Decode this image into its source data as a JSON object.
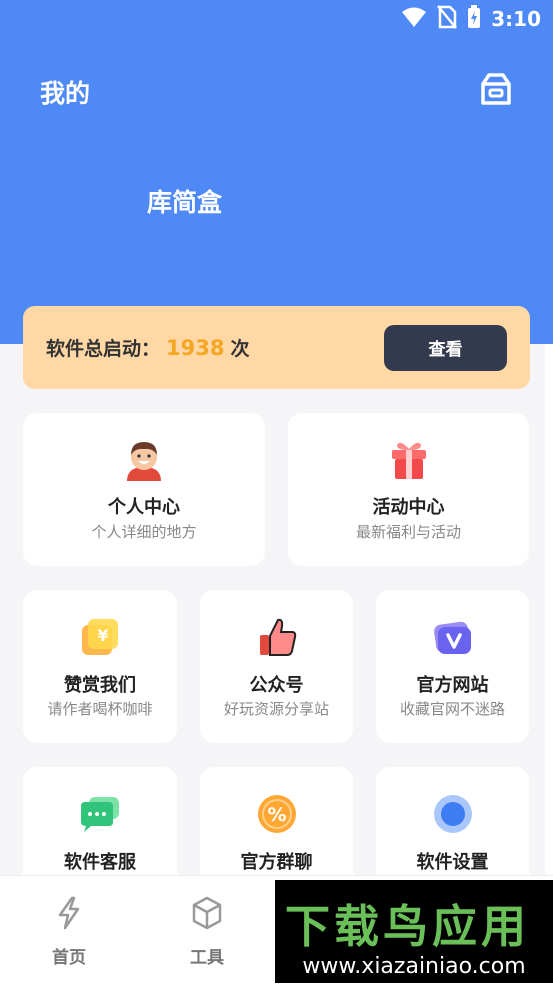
{
  "status_bar": {
    "time": "3:10"
  },
  "header": {
    "title": "我的",
    "app_name": "库简盒"
  },
  "launch": {
    "prefix": "软件总启动：",
    "count": "1938",
    "suffix": "次",
    "button": "查看"
  },
  "features_top": [
    {
      "label": "个人中心",
      "sub": "个人详细的地方",
      "icon": "avatar-icon"
    },
    {
      "label": "活动中心",
      "sub": "最新福利与活动",
      "icon": "gift-icon"
    }
  ],
  "features_row2": [
    {
      "label": "赞赏我们",
      "sub": "请作者喝杯咖啡",
      "icon": "yen-icon"
    },
    {
      "label": "公众号",
      "sub": "好玩资源分享站",
      "icon": "thumbs-up-icon"
    },
    {
      "label": "官方网站",
      "sub": "收藏官网不迷路",
      "icon": "website-icon"
    }
  ],
  "features_row3": [
    {
      "label": "软件客服",
      "icon": "chat-icon"
    },
    {
      "label": "官方群聊",
      "icon": "percent-icon"
    },
    {
      "label": "软件设置",
      "icon": "settings-dot-icon"
    }
  ],
  "tabs": [
    {
      "label": "首页",
      "icon": "lightning-icon"
    },
    {
      "label": "工具",
      "icon": "cube-icon"
    }
  ],
  "watermark": {
    "main": "下载鸟应用",
    "sub": "www.xiazainiao.com"
  }
}
